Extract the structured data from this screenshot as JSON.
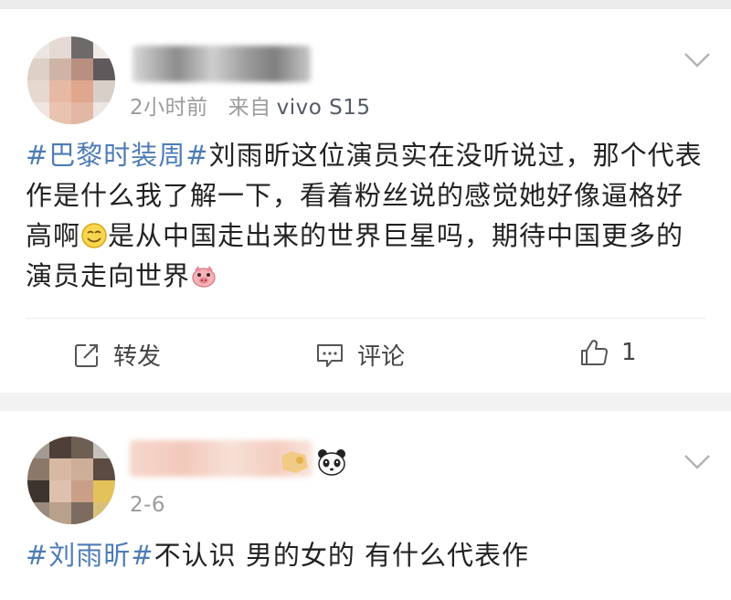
{
  "post1": {
    "time": "2小时前",
    "source_label": "来自",
    "device": "vivo S15",
    "hashtag": "#巴黎时装周#",
    "body_a": "刘雨昕这位演员实在没听说过，那个代表作是什么我了解一下，看着粉丝说的感觉她好像逼格好高啊",
    "body_b": "是从中国走出来的世界巨星吗，期待中国更多的演员走向世界",
    "emoji1_icon": "smile-emoji-icon",
    "emoji2_icon": "pig-emoji-icon",
    "actions": {
      "repost_label": "转发",
      "comment_label": "评论",
      "like_count": "1"
    }
  },
  "post2": {
    "date": "2-6",
    "hashtag": "#刘雨昕#",
    "body": "不认识 男的女的 有什么代表作",
    "badge_icon": "panda-icon"
  },
  "colors": {
    "hashtag": "#4e7cb6",
    "meta": "#9c9c9c",
    "background": "#f2f2f2"
  }
}
